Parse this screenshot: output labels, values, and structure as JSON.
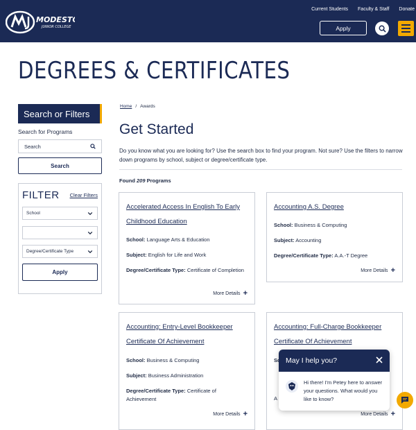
{
  "header": {
    "logo_text_primary": "MODESTO",
    "logo_text_secondary": "JUNIOR COLLEGE",
    "logo_icon": "mjc-logo-icon",
    "top_links": [
      "Current Students",
      "Faculty & Staff",
      "Donate"
    ],
    "apply_label": "Apply",
    "search_icon": "search-icon",
    "menu_icon": "hamburger-menu-icon"
  },
  "page_title": "DEGREES & CERTIFICATES",
  "sidebar": {
    "banner": "Search or Filters",
    "search_label": "Search for Programs",
    "search_placeholder": "Search",
    "search_button": "Search",
    "filter_title": "FILTER",
    "clear_filters": "Clear Filters",
    "selects": [
      {
        "selected": "School"
      },
      {
        "selected": ""
      },
      {
        "selected": "Degree/Certificate Type"
      }
    ],
    "apply_button": "Apply"
  },
  "breadcrumb": {
    "home": "Home",
    "separator": "/",
    "current": "Awards"
  },
  "main": {
    "heading": "Get Started",
    "intro": "Do you know what you are looking for? Use the search box to find your program. Not sure? Use the filters to narrow down programs by school, subject or degree/certificate type.",
    "found_prefix": "Found",
    "found_count": "209",
    "found_suffix": "Programs"
  },
  "labels": {
    "school": "School:",
    "subject": "Subject:",
    "degree_type": "Degree/Certificate Type:",
    "more_details": "More Details"
  },
  "cards": [
    {
      "title": "Accelerated Access In English To Early Childhood Education",
      "school": "Language Arts & Education",
      "subject": "English for Life and Work",
      "degree_type": "Certificate of Completion"
    },
    {
      "title": "Accounting A.S. Degree",
      "school": "Business & Computing",
      "subject": "Accounting",
      "degree_type": "A.A.-T Degree"
    },
    {
      "title": "Accounting: Entry-Level Bookkeeper Certificate Of Achievement",
      "school": "Business & Computing",
      "subject": "Business Administration",
      "degree_type": "Certificate of Achievement"
    },
    {
      "title": "Accounting: Full-Charge Bookkeeper Certificate Of Achievement",
      "school": "Sc",
      "subject": "",
      "degree_type": "A"
    }
  ],
  "chat": {
    "title": "May I help you?",
    "message": "Hi there! I'm Petey here to answer your questions. What would you like to know?",
    "close_icon": "close-icon",
    "avatar_icon": "petey-avatar-icon",
    "fab_icon": "chat-bubble-icon"
  },
  "colors": {
    "navy": "#1b2a55",
    "gold": "#f2a900",
    "border": "#c9cdd6"
  }
}
